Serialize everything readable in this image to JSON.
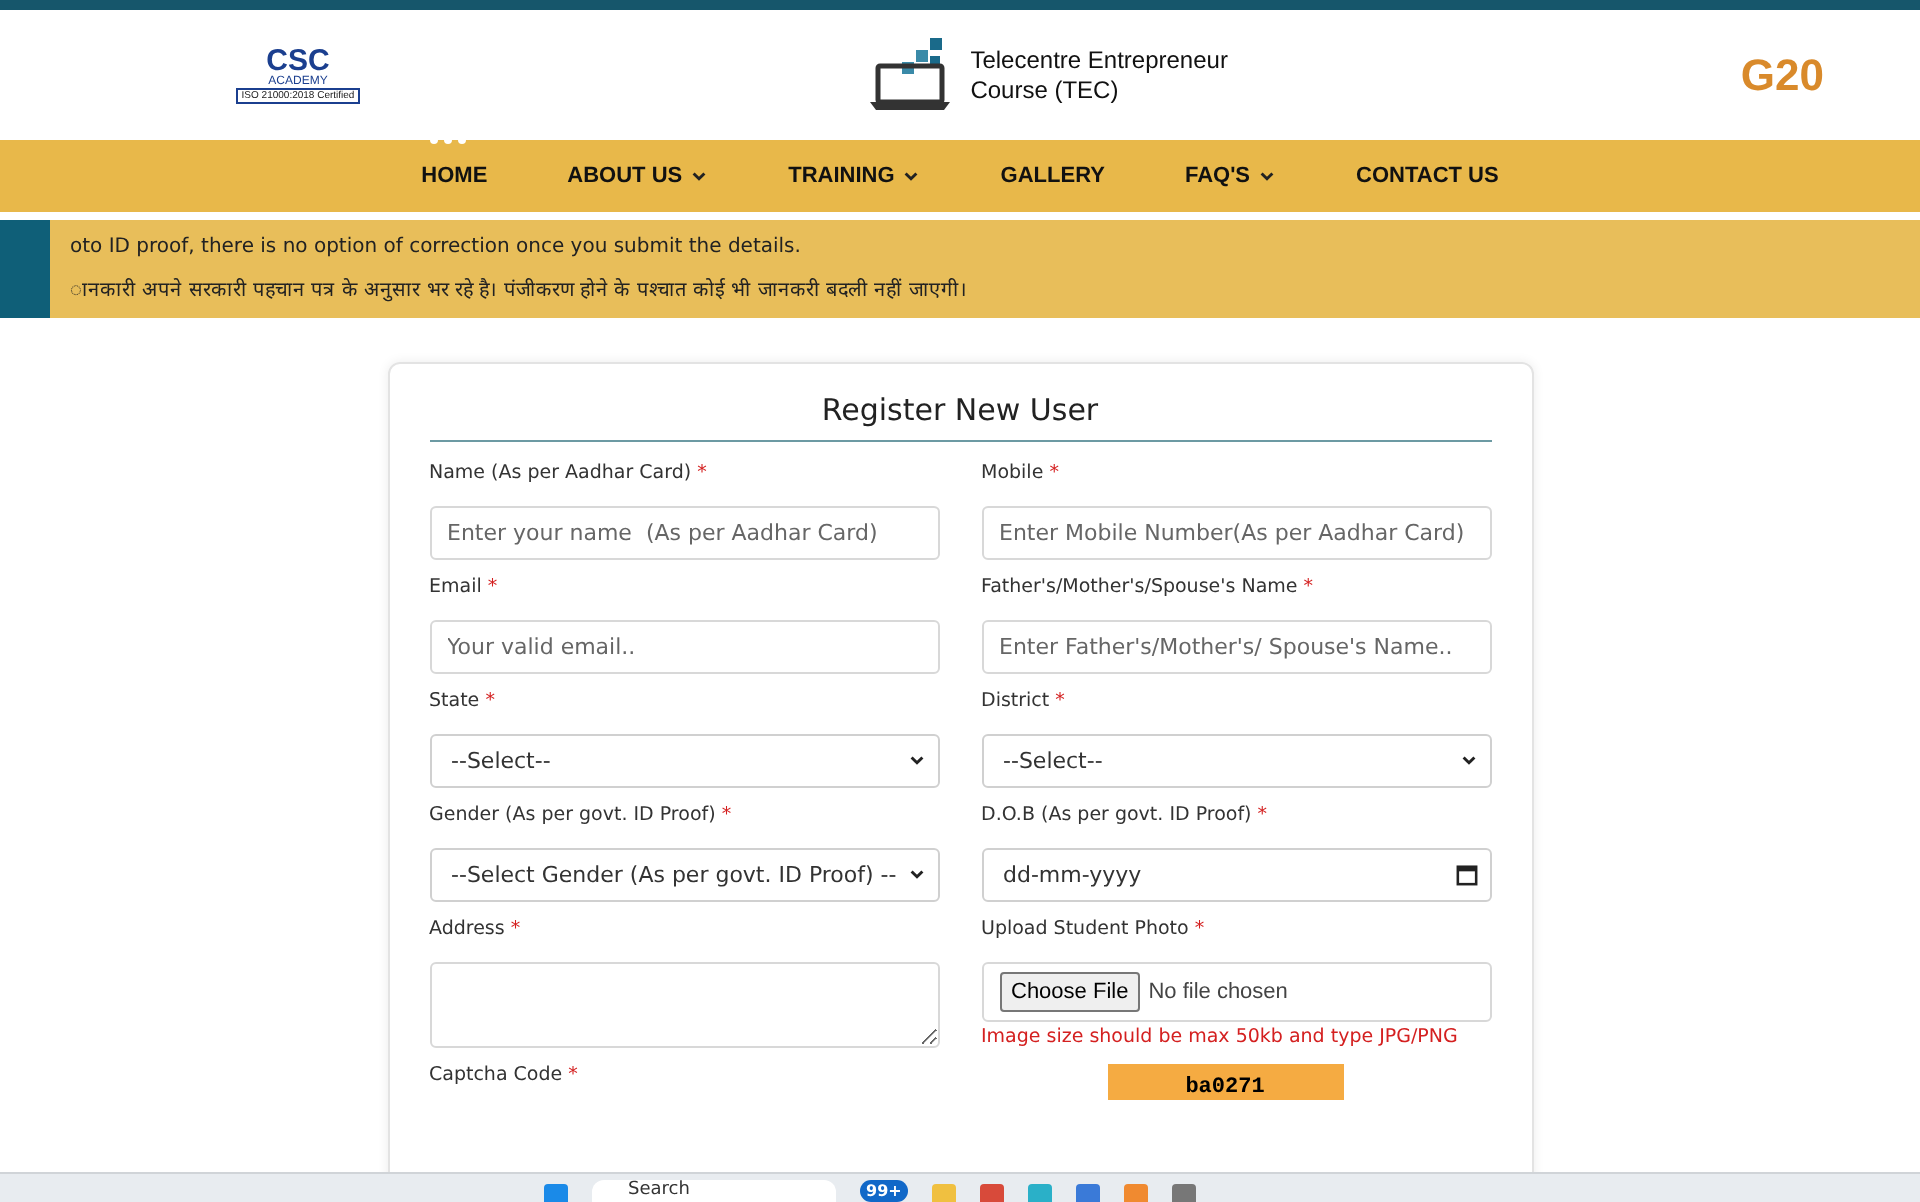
{
  "header": {
    "left_logo": {
      "mark": "CSC",
      "name": "ACADEMY",
      "certificate": "ISO 21000:2018 Certified"
    },
    "center_logo": {
      "title": "Telecentre Entrepreneur Course (TEC)"
    },
    "right_logo": {
      "mark": "G20"
    }
  },
  "nav": [
    {
      "label": "HOME",
      "selected": true,
      "dropdown": false
    },
    {
      "label": "ABOUT US",
      "selected": false,
      "dropdown": true
    },
    {
      "label": "TRAINING",
      "selected": false,
      "dropdown": true
    },
    {
      "label": "GALLERY",
      "selected": false,
      "dropdown": false
    },
    {
      "label": "FAQ'S",
      "selected": false,
      "dropdown": true
    },
    {
      "label": "CONTACT US",
      "selected": false,
      "dropdown": false
    }
  ],
  "notice": [
    "oto ID proof, there is no option of correction once you submit the details.",
    "ानकारी अपने सरकारी पहचान पत्र के अनुसार भर रहे है। पंजीकरण होने के पश्चात कोई भी जानकरी बदली नहीं जाएगी।"
  ],
  "form": {
    "title": "Register New User",
    "fields": [
      {
        "kind": "text",
        "label": "Name (As per Aadhar Card)",
        "required_mark": "*",
        "placeholder": "Enter your name  (As per Aadhar Card)"
      },
      {
        "kind": "text",
        "label": "Mobile",
        "required_mark": "*",
        "placeholder": "Enter Mobile Number(As per Aadhar Card)"
      },
      {
        "kind": "text",
        "label": "Email",
        "required_mark": "*",
        "placeholder": "Your valid email.."
      },
      {
        "kind": "text",
        "label": "Father's/Mother's/Spouse's Name",
        "required_mark": "*",
        "placeholder": "Enter Father's/Mother's/ Spouse's Name.."
      },
      {
        "kind": "select",
        "label": "State",
        "required_mark": "*",
        "value": "--Select--"
      },
      {
        "kind": "select",
        "label": "District",
        "required_mark": "*",
        "value": "--Select--"
      },
      {
        "kind": "select",
        "label": "Gender (As per govt. ID Proof)",
        "required_mark": "*",
        "value": "--Select Gender (As per govt. ID Proof) --"
      },
      {
        "kind": "date",
        "label": "D.O.B (As per govt. ID Proof)",
        "required_mark": "*",
        "value": "dd-mm-yyyy"
      },
      {
        "kind": "textarea",
        "label": "Address",
        "required_mark": "*"
      },
      {
        "kind": "file",
        "label": "Upload Student Photo",
        "required_mark": "*",
        "button": "Choose File",
        "value": "No file chosen",
        "hint": "Image size should be max 50kb and type JPG/PNG"
      },
      {
        "kind": "captcha",
        "label": "Captcha Code",
        "required_mark": "*",
        "value": "ba0271"
      }
    ]
  },
  "taskbar": {
    "search": "Search",
    "badge": "99+"
  }
}
